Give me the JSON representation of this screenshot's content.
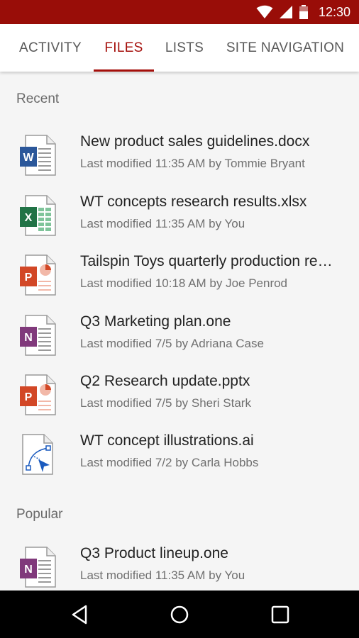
{
  "status_bar": {
    "time": "12:30",
    "icons": [
      "wifi-icon",
      "signal-icon",
      "battery-icon"
    ],
    "background": "#990d08"
  },
  "tabs": [
    {
      "label": "ACTIVITY",
      "active": false
    },
    {
      "label": "FILES",
      "active": true
    },
    {
      "label": "LISTS",
      "active": false
    },
    {
      "label": "SITE NAVIGATION",
      "active": false
    }
  ],
  "sections": {
    "recent_label": "Recent",
    "popular_label": "Popular"
  },
  "recent_files": [
    {
      "name": "New product sales guidelines.docx",
      "meta": "Last modified 11:35 AM by Tommie Bryant",
      "icon": "word-doc-icon",
      "letter": "W",
      "color": "#2b579a"
    },
    {
      "name": "WT concepts research results.xlsx",
      "meta": "Last modified 11:35 AM by You",
      "icon": "excel-sheet-icon",
      "letter": "X",
      "color": "#217346"
    },
    {
      "name": "Tailspin Toys quarterly production report.pptx",
      "meta": "Last modified 10:18 AM by Joe Penrod",
      "icon": "powerpoint-icon",
      "letter": "P",
      "color": "#d24726"
    },
    {
      "name": "Q3 Marketing plan.one",
      "meta": "Last modified 7/5 by Adriana Case",
      "icon": "onenote-icon",
      "letter": "N",
      "color": "#80397b"
    },
    {
      "name": "Q2 Research update.pptx",
      "meta": "Last modified 7/5 by Sheri Stark",
      "icon": "powerpoint-icon",
      "letter": "P",
      "color": "#d24726"
    },
    {
      "name": "WT concept illustrations.ai",
      "meta": "Last modified 7/2 by Carla Hobbs",
      "icon": "vector-file-icon",
      "letter": "",
      "color": "#1b5bbf"
    }
  ],
  "popular_files": [
    {
      "name": "Q3 Product lineup.one",
      "meta": "Last modified 11:35 AM by You",
      "icon": "onenote-icon",
      "letter": "N",
      "color": "#80397b"
    }
  ],
  "nav_bar": {
    "icons": [
      "back-icon",
      "home-icon",
      "recents-icon"
    ]
  }
}
